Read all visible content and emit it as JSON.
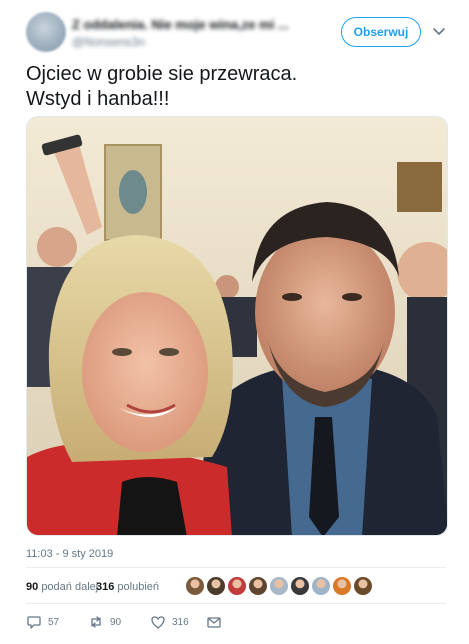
{
  "user": {
    "name": "Z oddalenia. Nie moje wina,ze mi ...",
    "handle": "@Nonsens3n",
    "follow_label": "Obserwuj"
  },
  "tweet": {
    "line1": "Ojciec w grobie sie przewraca.",
    "line2": "Wstyd i hanba!!!",
    "timestamp": "11:03 - 9 sty 2019"
  },
  "stats": {
    "retweets_count": "90",
    "retweets_label": "podań dalej",
    "likes_count": "316",
    "likes_label": "polubień",
    "liker_avatar_colors": [
      "#7a5a3a",
      "#4a3b2c",
      "#c23a3a",
      "#5e4630",
      "#a8b8c8",
      "#3a3a3a",
      "#9fb3c6",
      "#d97a2a",
      "#6b4a2a"
    ]
  },
  "actions": {
    "reply_count": "57",
    "retweet_count": "90",
    "like_count": "316"
  },
  "colors": {
    "accent": "#1da1f2",
    "muted": "#657786",
    "text": "#14171a"
  },
  "icons": [
    "chevron-down-icon",
    "reply-icon",
    "retweet-icon",
    "heart-icon",
    "message-icon"
  ]
}
